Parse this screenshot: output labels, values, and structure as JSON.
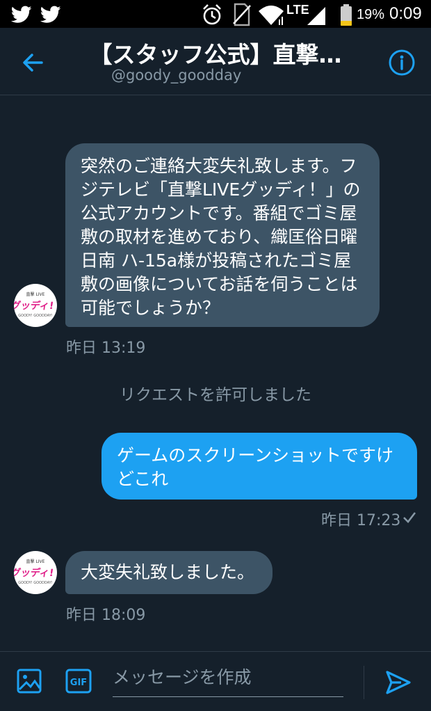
{
  "status_bar": {
    "battery": "19%",
    "time": "0:09",
    "network": "LTE"
  },
  "header": {
    "title": "【スタッフ公式】直撃…",
    "handle": "@goody_goodday"
  },
  "avatar": {
    "top_text": "直撃 LIVE",
    "logo_text": "グッディ!",
    "bottom_text": "GOODY! GOODDAY!"
  },
  "messages": [
    {
      "lines": [
        "突然のご連絡大変失礼致します。フ",
        "ジテレビ「直撃LIVEグッディ！」の",
        "公式アカウントです。番組でゴミ屋",
        "敷の取材を進めており、織匡俗日曜",
        "日南 ハ-15a様が投稿されたゴミ屋",
        "敷の画像についてお話を伺うことは",
        "可能でしょうか？"
      ],
      "timestamp": "昨日 13:19"
    },
    {
      "lines": [
        "ゲームのスクリーンショットですけ",
        "どこれ"
      ],
      "timestamp": "昨日 17:23"
    },
    {
      "lines": [
        "大変失礼致しました。"
      ],
      "timestamp": "昨日 18:09"
    }
  ],
  "system_message": "リクエストを許可しました",
  "composer": {
    "placeholder": "メッセージを作成",
    "gif_label": "GIF"
  },
  "colors": {
    "background": "#15202b",
    "accent": "#1da1f2",
    "incoming_bubble": "#3d5466",
    "muted_text": "#8899a6"
  }
}
